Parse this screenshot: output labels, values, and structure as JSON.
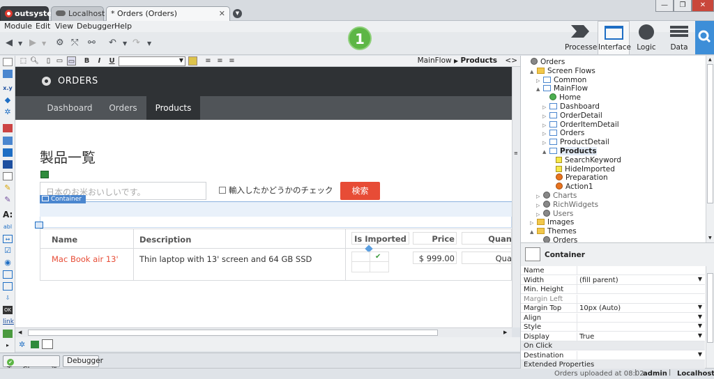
{
  "window": {
    "tabs": [
      {
        "label": "outsystems"
      },
      {
        "label": "Localhost"
      },
      {
        "label": "* Orders (Orders)",
        "close": "✕"
      }
    ],
    "controls": [
      "—",
      "❐",
      "✕"
    ]
  },
  "menu": [
    "Module",
    "Edit",
    "View",
    "Debugger",
    "Help"
  ],
  "toolbar": {
    "badge": "1",
    "nav": [
      {
        "label": "Processes",
        "icon": "processes-icon"
      },
      {
        "label": "Interface",
        "icon": "interface-icon"
      },
      {
        "label": "Logic",
        "icon": "logic-icon"
      },
      {
        "label": "Data",
        "icon": "data-icon"
      }
    ]
  },
  "editor_toolbar": {
    "bold": "B",
    "italic": "I",
    "underline": "U",
    "breadcrumb_flow": "MainFlow",
    "breadcrumb_screen": "Products",
    "code_toggle": "<>"
  },
  "app": {
    "title": "ORDERS",
    "nav": [
      "Dashboard",
      "Orders",
      "Products"
    ],
    "page_title": "製品一覧",
    "search_placeholder": "日本のお米おいしいです。",
    "checkbox_label": "輸入したかどうかのチェック",
    "search_button": "検索",
    "container_tag": "Container",
    "table": {
      "headers": [
        "Name",
        "Description",
        "Is Imported",
        "Price",
        "Quan"
      ],
      "rows": [
        {
          "name": "Mac Book air 13'",
          "description": "Thin laptop with 13' screen and 64 GB SSD",
          "imported": "✔",
          "price": "$ 999.00",
          "quantity": "Qua"
        }
      ]
    }
  },
  "bottom_tabs": [
    "TrueChange™",
    "Debugger"
  ],
  "status": {
    "message": "Orders uploaded at 08:02",
    "user": "admin",
    "server": "Localhost"
  },
  "tree": [
    {
      "label": "Orders",
      "icon": "globe",
      "depth": 0
    },
    {
      "label": "Screen Flows",
      "icon": "folder",
      "depth": 1,
      "arrow": "▲"
    },
    {
      "label": "Common",
      "icon": "screen",
      "depth": 2,
      "arrow": "▷"
    },
    {
      "label": "MainFlow",
      "icon": "screen",
      "depth": 2,
      "arrow": "▲"
    },
    {
      "label": "Home",
      "icon": "home",
      "depth": 3
    },
    {
      "label": "Dashboard",
      "icon": "screen",
      "depth": 3,
      "arrow": "▷"
    },
    {
      "label": "OrderDetail",
      "icon": "screen",
      "depth": 3,
      "arrow": "▷"
    },
    {
      "label": "OrderItemDetail",
      "icon": "screen",
      "depth": 3,
      "arrow": "▷"
    },
    {
      "label": "Orders",
      "icon": "screen",
      "depth": 3,
      "arrow": "▷"
    },
    {
      "label": "ProductDetail",
      "icon": "screen",
      "depth": 3,
      "arrow": "▷"
    },
    {
      "label": "Products",
      "icon": "screen",
      "depth": 3,
      "arrow": "▲",
      "bold": true
    },
    {
      "label": "SearchKeyword",
      "icon": "var",
      "depth": 4
    },
    {
      "label": "HideImported",
      "icon": "var",
      "depth": 4
    },
    {
      "label": "Preparation",
      "icon": "act",
      "depth": 4
    },
    {
      "label": "Action1",
      "icon": "act",
      "depth": 4
    },
    {
      "label": "Charts",
      "icon": "globe",
      "depth": 2,
      "arrow": "▷",
      "muted": true
    },
    {
      "label": "RichWidgets",
      "icon": "globe",
      "depth": 2,
      "arrow": "▷",
      "muted": true
    },
    {
      "label": "Users",
      "icon": "globe",
      "depth": 2,
      "arrow": "▷",
      "muted": true
    },
    {
      "label": "Images",
      "icon": "folder",
      "depth": 1,
      "arrow": "▷"
    },
    {
      "label": "Themes",
      "icon": "folder",
      "depth": 1,
      "arrow": "▲"
    },
    {
      "label": "Orders",
      "icon": "globe",
      "depth": 2
    }
  ],
  "properties": {
    "title": "Container",
    "rows": [
      {
        "key": "Name",
        "value": "",
        "dropdown": false
      },
      {
        "key": "Width",
        "value": "(fill parent)",
        "dropdown": true
      },
      {
        "key": "Min. Height",
        "value": "",
        "dropdown": false
      },
      {
        "key": "Margin Left",
        "value": "",
        "dropdown": false,
        "muted": true
      },
      {
        "key": "Margin Top",
        "value": "10px (Auto)",
        "dropdown": true
      },
      {
        "key": "Align",
        "value": "",
        "dropdown": true
      },
      {
        "key": "Style",
        "value": "",
        "dropdown": true
      },
      {
        "key": "Display",
        "value": "True",
        "dropdown": true
      },
      {
        "key": "On Click",
        "value": "",
        "dropdown": false,
        "section": true
      },
      {
        "key": "Destination",
        "value": "",
        "dropdown": true
      },
      {
        "key": "Extended Properties",
        "value": "",
        "dropdown": false,
        "section": true
      }
    ]
  },
  "colors": {
    "accent": "#3d8ed8",
    "brand_red": "#e74c36",
    "badge_green": "#5db645",
    "app_header": "#2f3235"
  }
}
